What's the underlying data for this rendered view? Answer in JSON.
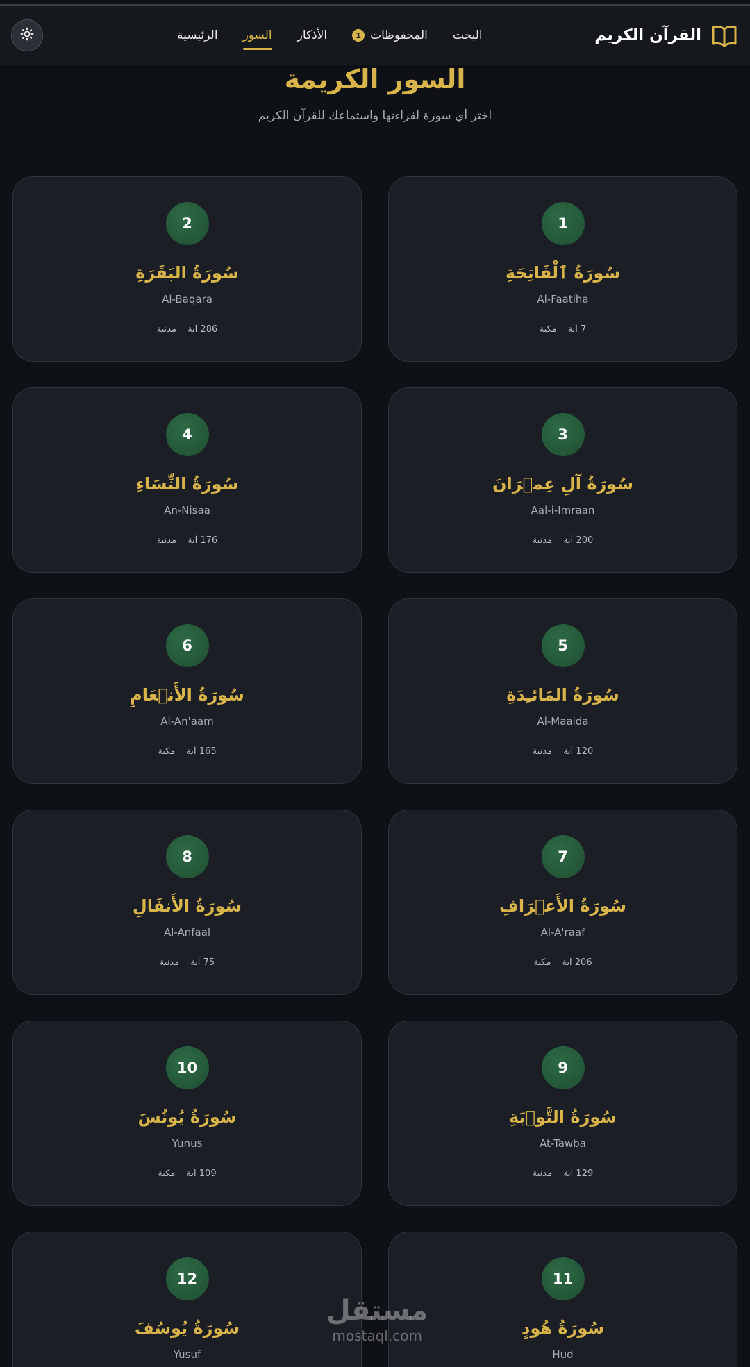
{
  "header": {
    "brand_title": "القرآن الكريم",
    "brand_icon": "book-icon",
    "nav": [
      {
        "label": "الرئيسية",
        "active": false
      },
      {
        "label": "السور",
        "active": true
      },
      {
        "label": "الأذكار",
        "active": false
      },
      {
        "label": "المحفوظات",
        "active": false,
        "badge": "1"
      },
      {
        "label": "البحث",
        "active": false
      }
    ],
    "theme_icon": "sun-icon"
  },
  "page": {
    "title": "السور الكريمة",
    "subtitle": "اختر أي سورة لقراءتها واستماعك للقرآن الكريم"
  },
  "ayah_word": "آية",
  "surahs": [
    {
      "number": "1",
      "name_ar": "سُورَةُ ٱلْفَاتِحَةِ",
      "name_en": "Al-Faatiha",
      "ayahs": "7",
      "type": "مكية"
    },
    {
      "number": "2",
      "name_ar": "سُورَةُ البَقَرَةِ",
      "name_en": "Al-Baqara",
      "ayahs": "286",
      "type": "مدنية"
    },
    {
      "number": "3",
      "name_ar": "سُورَةُ آلِ عِمۡرَانَ",
      "name_en": "Aal-i-Imraan",
      "ayahs": "200",
      "type": "مدنية"
    },
    {
      "number": "4",
      "name_ar": "سُورَةُ النِّسَاءِ",
      "name_en": "An-Nisaa",
      "ayahs": "176",
      "type": "مدنية"
    },
    {
      "number": "5",
      "name_ar": "سُورَةُ المَائـِدَةِ",
      "name_en": "Al-Maaida",
      "ayahs": "120",
      "type": "مدنية"
    },
    {
      "number": "6",
      "name_ar": "سُورَةُ الأَنۡعَامِ",
      "name_en": "Al-An'aam",
      "ayahs": "165",
      "type": "مكية"
    },
    {
      "number": "7",
      "name_ar": "سُورَةُ الأَعۡرَافِ",
      "name_en": "Al-A'raaf",
      "ayahs": "206",
      "type": "مكية"
    },
    {
      "number": "8",
      "name_ar": "سُورَةُ الأَنفَالِ",
      "name_en": "Al-Anfaal",
      "ayahs": "75",
      "type": "مدنية"
    },
    {
      "number": "9",
      "name_ar": "سُورَةُ التَّوۡبَةِ",
      "name_en": "At-Tawba",
      "ayahs": "129",
      "type": "مدنية"
    },
    {
      "number": "10",
      "name_ar": "سُورَةُ يُونُسَ",
      "name_en": "Yunus",
      "ayahs": "109",
      "type": "مكية"
    },
    {
      "number": "11",
      "name_ar": "سُورَةُ هُودٍ",
      "name_en": "Hud",
      "ayahs": "",
      "type": ""
    },
    {
      "number": "12",
      "name_ar": "سُورَةُ يُوسُفَ",
      "name_en": "Yusuf",
      "ayahs": "",
      "type": ""
    }
  ],
  "watermark": {
    "ar": "مستقل",
    "en": "mostaql.com"
  },
  "colors": {
    "accent": "#d9b44a",
    "background": "#0e1216",
    "card": "#1b1f25",
    "badge_green": "#2d6a44"
  }
}
